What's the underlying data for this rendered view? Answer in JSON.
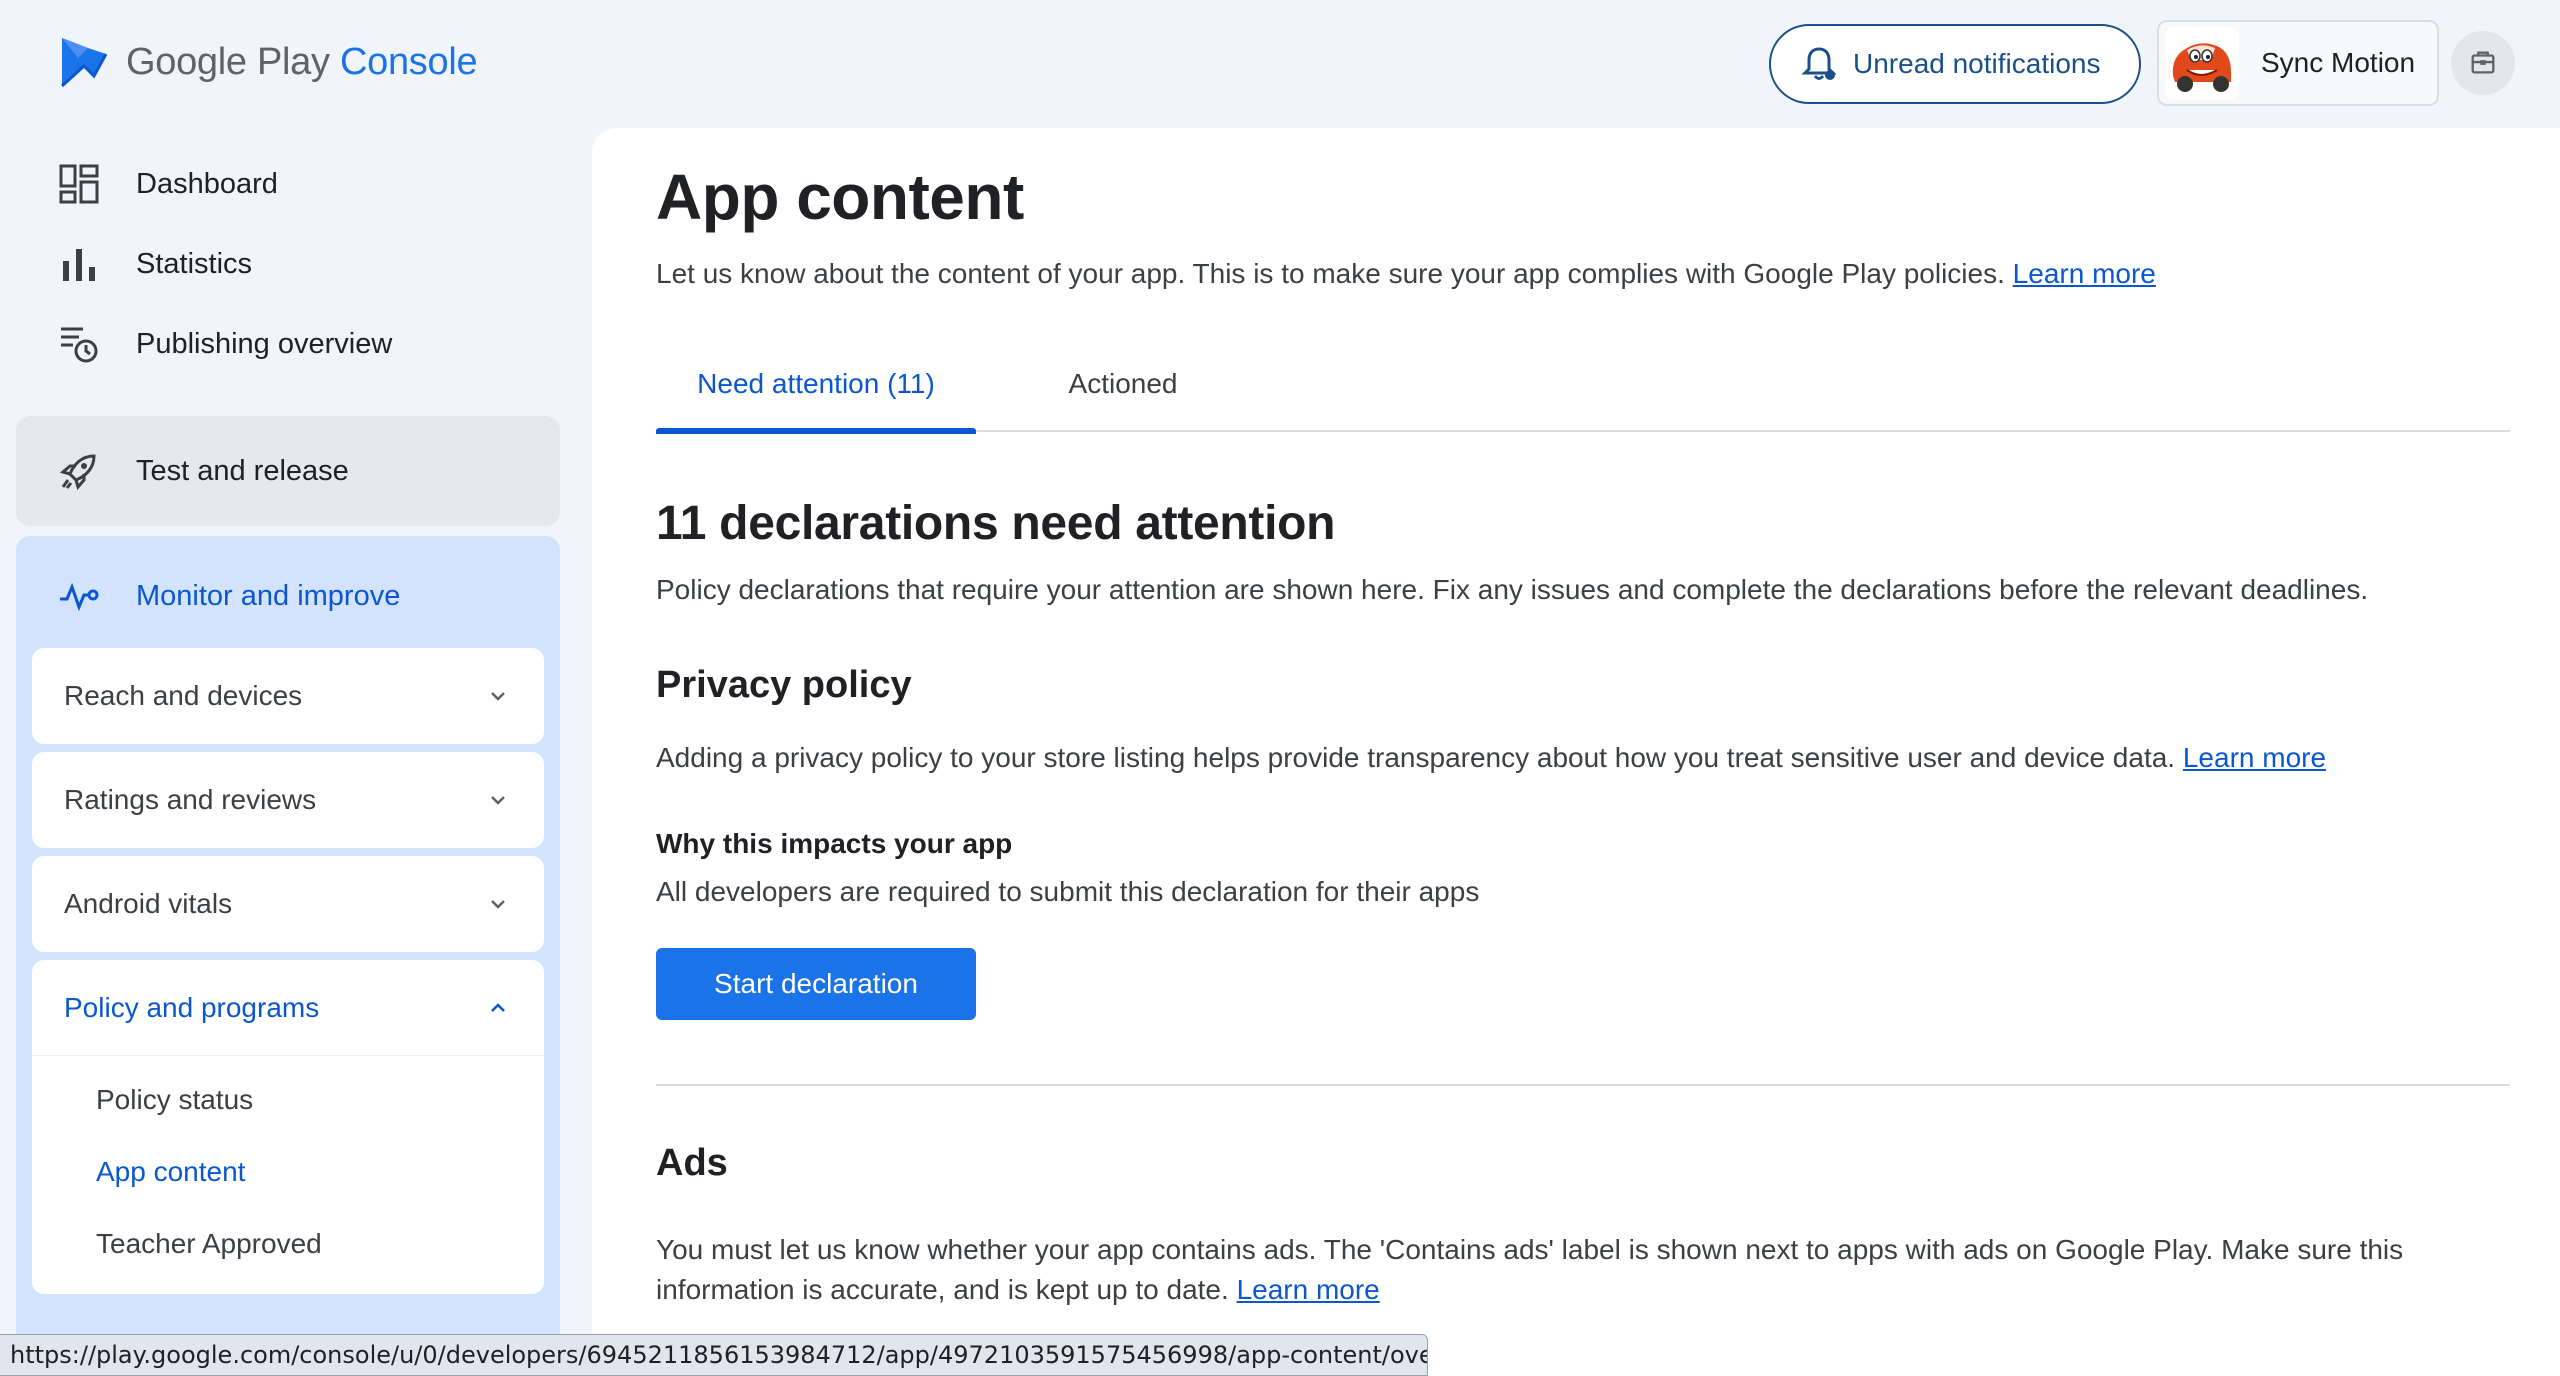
{
  "header": {
    "logo": {
      "brand": "Google Play",
      "product": "Console"
    },
    "notifications_label": "Unread notifications",
    "account_name": "Sync Motion"
  },
  "sidebar": {
    "items": [
      {
        "label": "Dashboard",
        "icon": "dashboard-icon"
      },
      {
        "label": "Statistics",
        "icon": "bar-chart-icon"
      },
      {
        "label": "Publishing overview",
        "icon": "publishing-history-icon"
      }
    ],
    "test_release": {
      "label": "Test and release",
      "icon": "rocket-icon"
    },
    "monitor": {
      "label": "Monitor and improve",
      "icon": "pulse-icon",
      "groups": [
        {
          "label": "Reach and devices",
          "expanded": false
        },
        {
          "label": "Ratings and reviews",
          "expanded": false
        },
        {
          "label": "Android vitals",
          "expanded": false
        },
        {
          "label": "Policy and programs",
          "expanded": true
        }
      ],
      "policy_children": [
        {
          "label": "Policy status",
          "active": false
        },
        {
          "label": "App content",
          "active": true
        },
        {
          "label": "Teacher Approved",
          "active": false
        }
      ]
    }
  },
  "main": {
    "title": "App content",
    "subtitle": "Let us know about the content of your app. This is to make sure your app complies with Google Play policies.",
    "learn_more": "Learn more",
    "tabs": [
      {
        "label": "Need attention (11)",
        "active": true
      },
      {
        "label": "Actioned",
        "active": false
      }
    ],
    "attention_heading": "11 declarations need attention",
    "attention_text": "Policy declarations that require your attention are shown here. Fix any issues and complete the declarations before the relevant deadlines.",
    "privacy": {
      "heading": "Privacy policy",
      "text": "Adding a privacy policy to your store listing helps provide transparency about how you treat sensitive user and device data.",
      "learn_more": "Learn more",
      "impact_heading": "Why this impacts your app",
      "impact_text": "All developers are required to submit this declaration for their apps",
      "button": "Start declaration"
    },
    "ads": {
      "heading": "Ads",
      "text": "You must let us know whether your app contains ads. The 'Contains ads' label is shown next to apps with ads on Google Play. Make sure this information is accurate, and is kept up to date.",
      "learn_more": "Learn more"
    }
  },
  "statusbar": {
    "url": "https://play.google.com/console/u/0/developers/6945211856153984712/app/4972103591575456998/app-content/overview"
  },
  "colors": {
    "accent": "#0b57d0",
    "primary_button": "#1a73e8",
    "sidebar_active_bg": "#d3e3fd",
    "page_bg": "#f1f4f9"
  }
}
